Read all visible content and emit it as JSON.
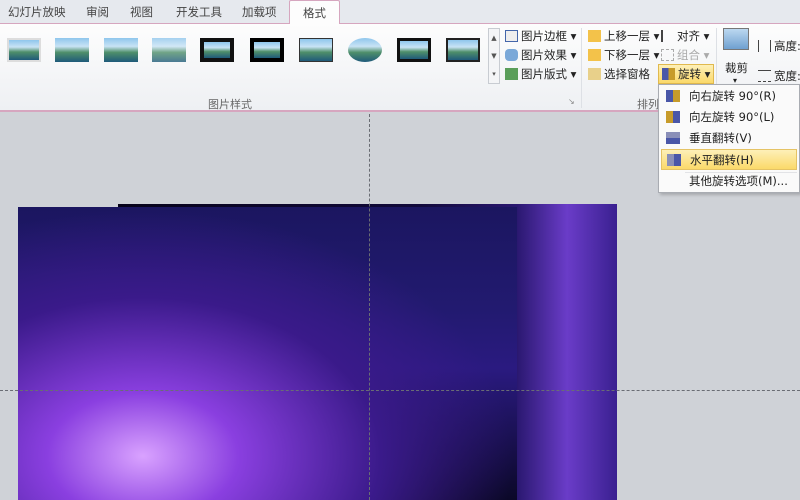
{
  "tabs": [
    {
      "label": "幻灯片放映"
    },
    {
      "label": "审阅"
    },
    {
      "label": "视图"
    },
    {
      "label": "开发工具"
    },
    {
      "label": "加载项"
    },
    {
      "label": "格式",
      "active": true
    }
  ],
  "picture_styles": {
    "group_label": "图片样式",
    "border": "图片边框",
    "effects": "图片效果",
    "layout": "图片版式"
  },
  "arrange": {
    "group_label": "排列",
    "bring_forward": "上移一层",
    "send_backward": "下移一层",
    "selection_pane": "选择窗格",
    "align": "对齐",
    "group": "组合",
    "rotate": "旋转"
  },
  "size": {
    "crop": "裁剪",
    "height": "高度:",
    "width": "宽度:"
  },
  "rotate_menu": [
    {
      "label": "向右旋转 90°(R)"
    },
    {
      "label": "向左旋转 90°(L)"
    },
    {
      "label": "垂直翻转(V)"
    },
    {
      "label": "水平翻转(H)",
      "highlighted": true
    },
    {
      "label": "其他旋转选项(M)..."
    }
  ],
  "colors": {
    "accent": "#d6a6bf",
    "highlight": "#fbd96a"
  }
}
